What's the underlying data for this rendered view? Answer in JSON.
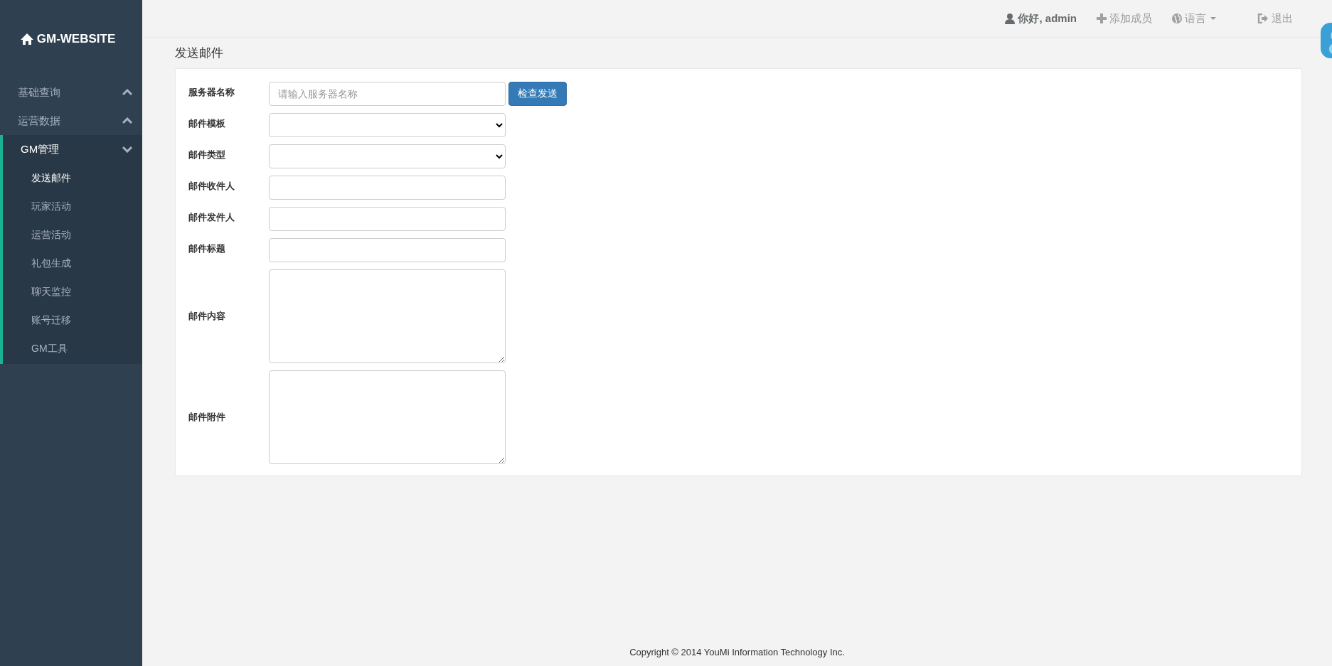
{
  "brand": {
    "title": "GM-WEBSITE"
  },
  "sidebar": {
    "items": [
      {
        "label": "基础查询",
        "expanded": false
      },
      {
        "label": "运营数据",
        "expanded": false
      },
      {
        "label": "GM管理",
        "expanded": true,
        "children": [
          {
            "label": "发送邮件",
            "selected": true
          },
          {
            "label": "玩家活动",
            "selected": false
          },
          {
            "label": "运营活动",
            "selected": false
          },
          {
            "label": "礼包生成",
            "selected": false
          },
          {
            "label": "聊天监控",
            "selected": false
          },
          {
            "label": "账号迁移",
            "selected": false
          },
          {
            "label": "GM工具",
            "selected": false
          }
        ]
      }
    ]
  },
  "topbar": {
    "items": [
      {
        "kind": "user",
        "label": "你好, admin"
      },
      {
        "kind": "add",
        "label": "添加成员"
      },
      {
        "kind": "language",
        "label": "语言"
      },
      {
        "kind": "logout",
        "label": "退出"
      }
    ]
  },
  "page_title": "发送邮件",
  "form": {
    "fields": [
      {
        "label": "服务器名称",
        "kind": "text",
        "placeholder": "请输入服务器名称",
        "button": "检查发送"
      },
      {
        "label": "邮件模板",
        "kind": "select"
      },
      {
        "label": "邮件类型",
        "kind": "select"
      },
      {
        "label": "邮件收件人",
        "kind": "text"
      },
      {
        "label": "邮件发件人",
        "kind": "text"
      },
      {
        "label": "邮件标题",
        "kind": "text"
      },
      {
        "label": "邮件内容",
        "kind": "textarea"
      },
      {
        "label": "邮件附件",
        "kind": "textarea"
      }
    ]
  },
  "footer": {
    "text": "Copyright © 2014 YouMi Information Technology Inc."
  }
}
